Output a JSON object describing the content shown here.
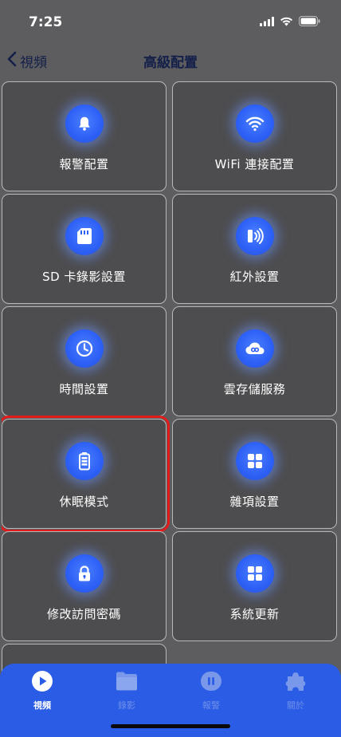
{
  "status": {
    "time": "7:25"
  },
  "nav": {
    "back_label": "視頻",
    "title": "高級配置"
  },
  "tiles": [
    {
      "label": "報警配置",
      "icon": "bell-icon"
    },
    {
      "label": "WiFi 連接配置",
      "icon": "wifi-icon"
    },
    {
      "label": "SD 卡錄影設置",
      "icon": "sd-card-icon"
    },
    {
      "label": "紅外設置",
      "icon": "infrared-icon"
    },
    {
      "label": "時間設置",
      "icon": "clock-icon"
    },
    {
      "label": "雲存儲服務",
      "icon": "cloud-icon"
    },
    {
      "label": "休眠模式",
      "icon": "battery-icon",
      "selected": true
    },
    {
      "label": "雜項設置",
      "icon": "grid-icon"
    },
    {
      "label": "修改訪問密碼",
      "icon": "lock-icon"
    },
    {
      "label": "系統更新",
      "icon": "grid-icon"
    }
  ],
  "tabs": [
    {
      "label": "視頻",
      "icon": "play-icon",
      "active": true
    },
    {
      "label": "錄影",
      "icon": "folder-icon",
      "active": false
    },
    {
      "label": "報警",
      "icon": "alarm-icon",
      "active": false
    },
    {
      "label": "關於",
      "icon": "puzzle-icon",
      "active": false
    }
  ],
  "colors": {
    "background": "#5d5d5f",
    "tile": "#4d4d4f",
    "accent": "#2c5ff5",
    "tab_bar": "#2a5ce6",
    "selection": "#e21b1b",
    "nav_text": "#14204a"
  }
}
